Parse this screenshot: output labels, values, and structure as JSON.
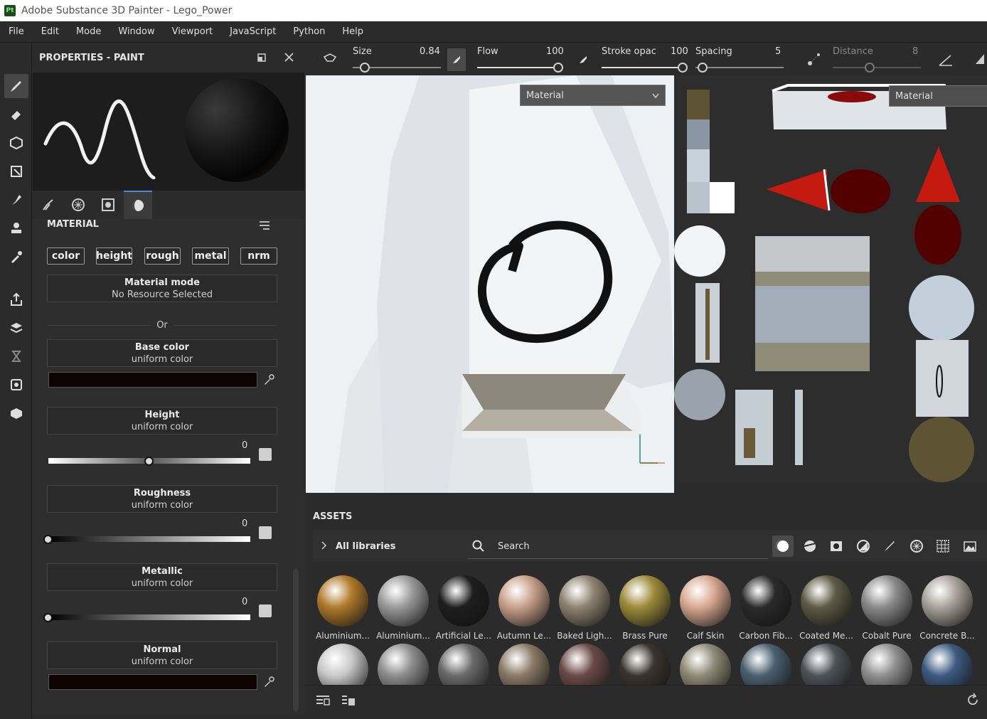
{
  "window": {
    "title": "Adobe Substance 3D Painter - Lego_Power",
    "app_badge": "Pt"
  },
  "menu": [
    "File",
    "Edit",
    "Mode",
    "Window",
    "Viewport",
    "JavaScript",
    "Python",
    "Help"
  ],
  "properties": {
    "title": "PROPERTIES - PAINT",
    "section": "MATERIAL",
    "channels": [
      "color",
      "height",
      "rough",
      "metal",
      "nrm"
    ],
    "material_mode": {
      "label": "Material mode",
      "value": "No Resource Selected"
    },
    "or_label": "Or",
    "base_color": {
      "label": "Base color",
      "sub": "uniform color",
      "swatch": "#0d0303"
    },
    "height": {
      "label": "Height",
      "sub": "uniform color",
      "value": "0",
      "fraction": 0.5
    },
    "roughness": {
      "label": "Roughness",
      "sub": "uniform color",
      "value": "0",
      "fraction": 0.0
    },
    "metallic": {
      "label": "Metallic",
      "sub": "uniform color",
      "value": "0",
      "fraction": 0.0
    },
    "normal": {
      "label": "Normal",
      "sub": "uniform color",
      "swatch": "#0d0303"
    }
  },
  "brush": {
    "size": {
      "label": "Size",
      "value": "0.84"
    },
    "flow": {
      "label": "Flow",
      "value": "100"
    },
    "stroke_opacity": {
      "label": "Stroke opac",
      "value": "100"
    },
    "spacing": {
      "label": "Spacing",
      "value": "5"
    },
    "distance": {
      "label": "Distance",
      "value": "8"
    }
  },
  "viewport": {
    "mode_3d": "Material",
    "mode_2d": "Material"
  },
  "assets": {
    "title": "ASSETS",
    "library": "All libraries",
    "search_placeholder": "Search",
    "row1": [
      {
        "name": "Aluminium...",
        "color": "#b07a2a"
      },
      {
        "name": "Aluminium...",
        "color": "#9a9a9a"
      },
      {
        "name": "Artificial Le...",
        "color": "#1e1e1e"
      },
      {
        "name": "Autumn Le...",
        "color": "#c9a08a"
      },
      {
        "name": "Baked Ligh...",
        "color": "#8f8270"
      },
      {
        "name": "Brass Pure",
        "color": "#9c8a3a"
      },
      {
        "name": "Calf Skin",
        "color": "#d8a890"
      },
      {
        "name": "Carbon Fib...",
        "color": "#2a2a2a"
      },
      {
        "name": "Coated Me...",
        "color": "#5e5a45"
      },
      {
        "name": "Cobalt Pure",
        "color": "#8a8a8a"
      },
      {
        "name": "Concrete B...",
        "color": "#a8a29a"
      }
    ],
    "row2_colors": [
      "#c9c9c9",
      "#8d8d8d",
      "#6a6a6a",
      "#8a7a66",
      "#6a4a48",
      "#3a342e",
      "#8e8a76",
      "#4a6070",
      "#4d5258",
      "#8f8f8f",
      "#3c5a80"
    ]
  }
}
